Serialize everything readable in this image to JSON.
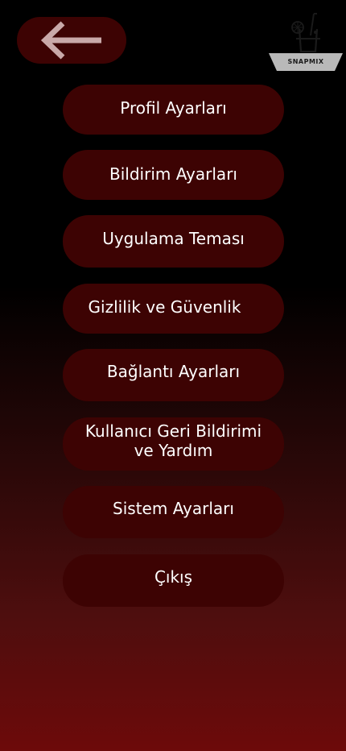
{
  "header": {
    "back_icon": "arrow-left-icon",
    "logo_icon": "cocktail-glass-icon",
    "logo_text": "SNAPMIX"
  },
  "menu": {
    "items": [
      {
        "label": "Profil Ayarları"
      },
      {
        "label": "Bildirim Ayarları"
      },
      {
        "label": "Uygulama Teması"
      },
      {
        "label": "Gizlilik ve Güvenlik"
      },
      {
        "label": "Bağlantı Ayarları"
      },
      {
        "label": "Kullanıcı Geri Bildirimi\nve Yardım"
      },
      {
        "label": "Sistem Ayarları"
      },
      {
        "label": "Çıkış"
      }
    ]
  },
  "colors": {
    "button_bg": "#3d0303",
    "arrow": "#c9a9a9",
    "gradient_bottom": "#6d0a0a"
  }
}
